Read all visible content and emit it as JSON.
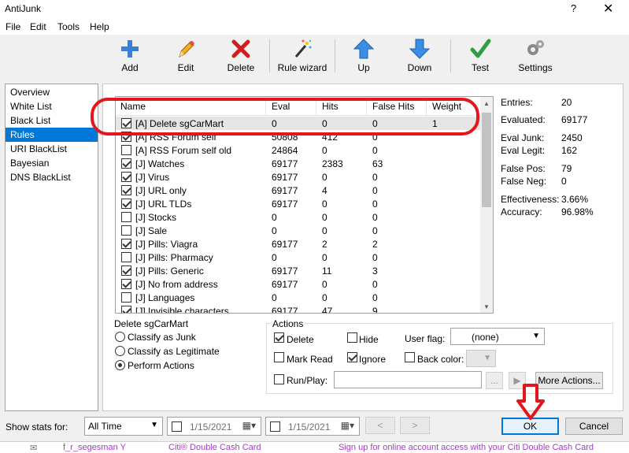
{
  "window": {
    "title": "AntiJunk",
    "help": "?",
    "close": "✕"
  },
  "menu": [
    "File",
    "Edit",
    "Tools",
    "Help"
  ],
  "toolbar": {
    "add": "Add",
    "edit": "Edit",
    "delete": "Delete",
    "rule_wizard": "Rule wizard",
    "up": "Up",
    "down": "Down",
    "test": "Test",
    "settings": "Settings"
  },
  "nav": [
    "Overview",
    "White List",
    "Black List",
    "Rules",
    "URI BlackList",
    "Bayesian",
    "DNS BlackList"
  ],
  "nav_selected": "Rules",
  "grid": {
    "headers": [
      "Name",
      "Eval",
      "Hits",
      "False Hits",
      "Weight"
    ],
    "rows": [
      {
        "checked": true,
        "name": "[A] Delete sgCarMart",
        "eval": "0",
        "hits": "0",
        "false_hits": "0",
        "weight": "1"
      },
      {
        "checked": true,
        "name": "[A] RSS Forum self",
        "eval": "50808",
        "hits": "412",
        "false_hits": "0",
        "weight": ""
      },
      {
        "checked": false,
        "name": "[A] RSS Forum self old",
        "eval": "24864",
        "hits": "0",
        "false_hits": "0",
        "weight": ""
      },
      {
        "checked": true,
        "name": "[J] Watches",
        "eval": "69177",
        "hits": "2383",
        "false_hits": "63",
        "weight": ""
      },
      {
        "checked": true,
        "name": "[J] Virus",
        "eval": "69177",
        "hits": "0",
        "false_hits": "0",
        "weight": ""
      },
      {
        "checked": true,
        "name": "[J] URL only",
        "eval": "69177",
        "hits": "4",
        "false_hits": "0",
        "weight": ""
      },
      {
        "checked": true,
        "name": "[J] URL TLDs",
        "eval": "69177",
        "hits": "0",
        "false_hits": "0",
        "weight": ""
      },
      {
        "checked": false,
        "name": "[J] Stocks",
        "eval": "0",
        "hits": "0",
        "false_hits": "0",
        "weight": ""
      },
      {
        "checked": false,
        "name": "[J] Sale",
        "eval": "0",
        "hits": "0",
        "false_hits": "0",
        "weight": ""
      },
      {
        "checked": true,
        "name": "[J] Pills: Viagra",
        "eval": "69177",
        "hits": "2",
        "false_hits": "2",
        "weight": ""
      },
      {
        "checked": false,
        "name": "[J] Pills: Pharmacy",
        "eval": "0",
        "hits": "0",
        "false_hits": "0",
        "weight": ""
      },
      {
        "checked": true,
        "name": "[J] Pills: Generic",
        "eval": "69177",
        "hits": "11",
        "false_hits": "3",
        "weight": ""
      },
      {
        "checked": true,
        "name": "[J] No from address",
        "eval": "69177",
        "hits": "0",
        "false_hits": "0",
        "weight": ""
      },
      {
        "checked": false,
        "name": "[J] Languages",
        "eval": "0",
        "hits": "0",
        "false_hits": "0",
        "weight": ""
      },
      {
        "checked": true,
        "name": "[J] Invisible characters",
        "eval": "69177",
        "hits": "47",
        "false_hits": "9",
        "weight": ""
      }
    ]
  },
  "stats": {
    "entries_label": "Entries:",
    "entries": "20",
    "evaluated_label": "Evaluated:",
    "evaluated": "69177",
    "eval_junk_label": "Eval Junk:",
    "eval_junk": "2450",
    "eval_legit_label": "Eval Legit:",
    "eval_legit": "162",
    "false_pos_label": "False Pos:",
    "false_pos": "79",
    "false_neg_label": "False Neg:",
    "false_neg": "0",
    "effectiveness_label": "Effectiveness:",
    "effectiveness": "3.66%",
    "accuracy_label": "Accuracy:",
    "accuracy": "96.98%"
  },
  "rule_group": {
    "title": "Delete sgCarMart",
    "options": [
      "Classify as Junk",
      "Classify as Legitimate",
      "Perform Actions"
    ],
    "selected": "Perform Actions"
  },
  "actions": {
    "title": "Actions",
    "delete": "Delete",
    "delete_checked": true,
    "hide": "Hide",
    "hide_checked": false,
    "user_flag_label": "User flag:",
    "user_flag_value": "(none)",
    "mark_read": "Mark Read",
    "mark_read_checked": false,
    "ignore": "Ignore",
    "ignore_checked": true,
    "back_color": "Back color:",
    "back_color_checked": false,
    "run_play": "Run/Play:",
    "run_play_checked": false,
    "browse": "...",
    "play": "▶",
    "more_actions": "More Actions..."
  },
  "bottom": {
    "show_stats_label": "Show stats for:",
    "range": "All Time",
    "date_from": "1/15/2021",
    "date_to": "1/15/2021",
    "prev": "<",
    "next": ">",
    "ok": "OK",
    "cancel": "Cancel"
  },
  "background_strip": {
    "sender": "f_r_segesman Y",
    "subject": "Citi® Double Cash Card",
    "preview": "Sign up for online account access with your Citi Double Cash Card"
  },
  "colors": {
    "accent": "#0078d7",
    "annotation": "#e3161c"
  }
}
